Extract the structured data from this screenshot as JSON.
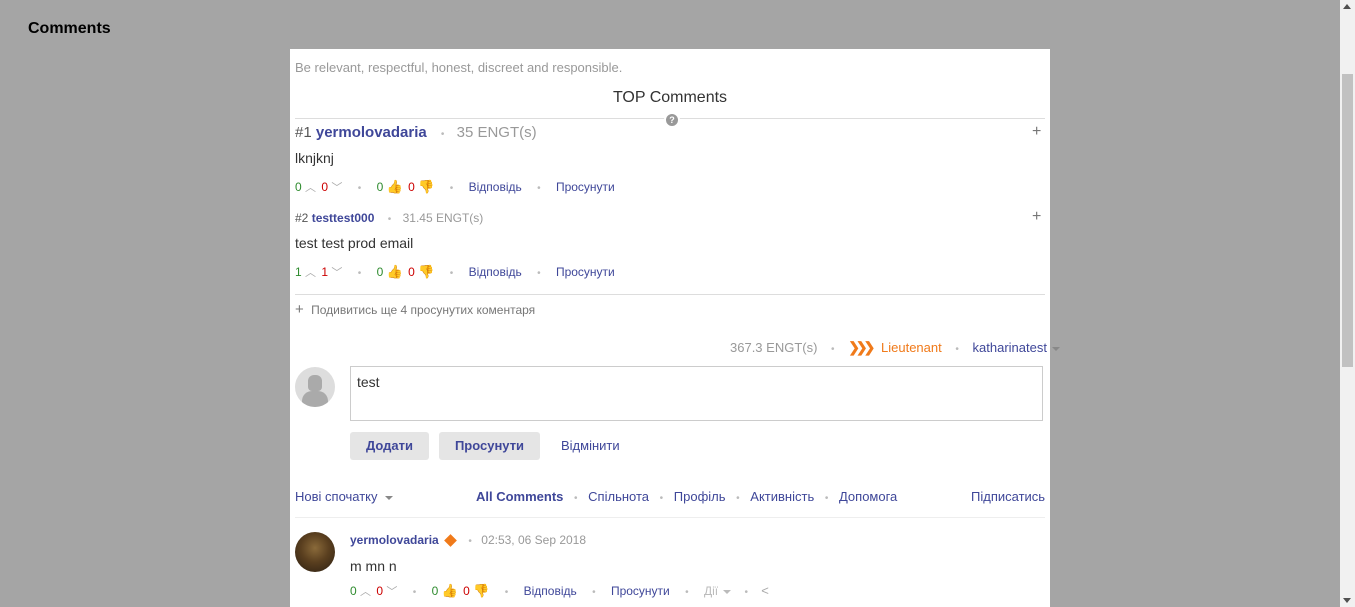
{
  "page": {
    "title": "Comments"
  },
  "panel": {
    "guidelines": "Be relevant, respectful, honest, discreet and responsible.",
    "top_heading": "TOP Comments",
    "help_icon": "?",
    "top_comments": [
      {
        "rank": "#1",
        "user": "yermolovadaria",
        "amount": "35 ENGT(s)",
        "text": "lknjknj",
        "up": "0",
        "down": "0",
        "likes": "0",
        "dislikes": "0",
        "reply": "Відповідь",
        "promote": "Просунути"
      },
      {
        "rank": "#2",
        "user": "testtest000",
        "amount": "31.45 ENGT(s)",
        "text": "test test prod email",
        "up": "1",
        "down": "1",
        "likes": "0",
        "dislikes": "0",
        "reply": "Відповідь",
        "promote": "Просунути"
      }
    ],
    "more_promoted": "Подивитись ще 4 просунутих коментаря",
    "user_balance": "367.3 ENGT(s)",
    "user_rank": "Lieutenant",
    "current_user": "katharinatest",
    "compose": {
      "value": "test",
      "add_button": "Додати",
      "promote_button": "Просунути",
      "cancel_button": "Відмінити"
    },
    "nav": {
      "sort": "Нові спочатку",
      "tabs": [
        "All Comments",
        "Спільнота",
        "Профіль",
        "Активність",
        "Допомога"
      ],
      "subscribe": "Підписатись"
    },
    "comment": {
      "user": "yermolovadaria",
      "timestamp": "02:53, 06 Sep 2018",
      "text": "m mn n",
      "up": "0",
      "down": "0",
      "likes": "0",
      "dislikes": "0",
      "reply": "Відповідь",
      "promote": "Просунути",
      "actions": "Дії"
    }
  },
  "colors": {
    "link": "#3f4799",
    "rank": "#f07a1a",
    "up": "#2e8b2e",
    "down": "#cc0000"
  },
  "icons": [
    "thumbs-up-icon",
    "thumbs-down-icon",
    "chevron-up-icon",
    "chevron-down-icon",
    "plus-icon",
    "share-icon",
    "help-icon",
    "rank-chevrons-icon",
    "diamond-badge-icon",
    "default-avatar-icon"
  ]
}
